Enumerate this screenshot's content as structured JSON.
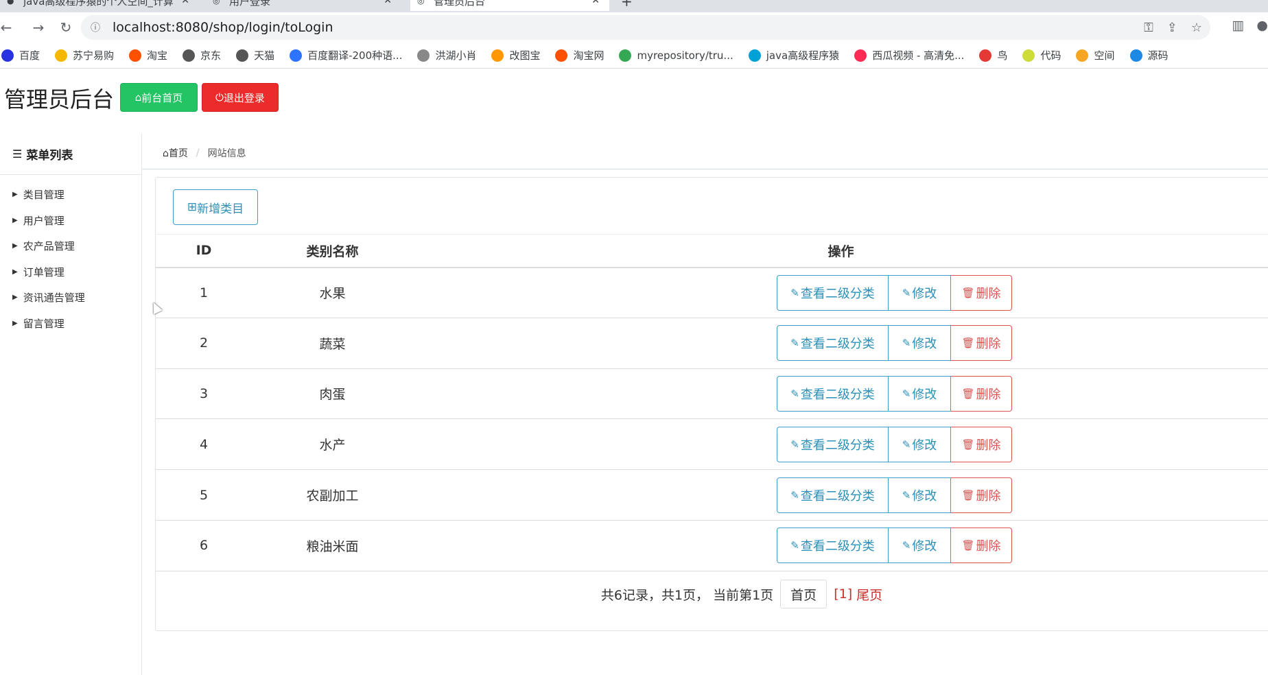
{
  "browser": {
    "tabs": [
      {
        "label": "java高级程序猿的个人空间_计算"
      },
      {
        "label": "用户登录"
      },
      {
        "label": "管理员后台"
      }
    ],
    "url": "localhost:8080/shop/login/toLogin",
    "bookmarks": [
      {
        "label": "百度",
        "color": "#2932e1"
      },
      {
        "label": "苏宁易购",
        "color": "#f5b800"
      },
      {
        "label": "淘宝",
        "color": "#ff5000"
      },
      {
        "label": "京东",
        "color": "#555555"
      },
      {
        "label": "天猫",
        "color": "#555555"
      },
      {
        "label": "百度翻译-200种语...",
        "color": "#2c73ff"
      },
      {
        "label": "洪湖小肖",
        "color": "#888888"
      },
      {
        "label": "改图宝",
        "color": "#ff9800"
      },
      {
        "label": "淘宝网",
        "color": "#ff5000"
      },
      {
        "label": "myrepository/tru...",
        "color": "#34a853"
      },
      {
        "label": "java高级程序猿",
        "color": "#00a1d6"
      },
      {
        "label": "西瓜视频 - 高清免...",
        "color": "#fe2c55"
      },
      {
        "label": "鸟",
        "color": "#e53935"
      },
      {
        "label": "代码",
        "color": "#cddc39"
      },
      {
        "label": "空间",
        "color": "#f5a623"
      },
      {
        "label": "源码",
        "color": "#1e88e5"
      }
    ]
  },
  "header": {
    "title": "管理员后台",
    "home_label": "前台首页",
    "logout_label": "退出登录"
  },
  "sidebar": {
    "title": "菜单列表",
    "items": [
      {
        "label": "类目管理"
      },
      {
        "label": "用户管理"
      },
      {
        "label": "农产品管理"
      },
      {
        "label": "订单管理"
      },
      {
        "label": "资讯通告管理"
      },
      {
        "label": "留言管理"
      }
    ]
  },
  "breadcrumb": {
    "home": "首页",
    "current": "网站信息"
  },
  "main": {
    "add_label": "新增类目",
    "columns": [
      "ID",
      "类别名称",
      "操作"
    ],
    "rows": [
      {
        "id": "1",
        "name": "水果"
      },
      {
        "id": "2",
        "name": "蔬菜"
      },
      {
        "id": "3",
        "name": "肉蛋"
      },
      {
        "id": "4",
        "name": "水产"
      },
      {
        "id": "5",
        "name": "农副加工"
      },
      {
        "id": "6",
        "name": "粮油米面"
      }
    ],
    "ops": {
      "view": "查看二级分类",
      "edit": "修改",
      "delete": "删除"
    },
    "pager": {
      "summary": "共6记录，共1页， 当前第1页",
      "first": "首页",
      "current": "[1]",
      "last": "尾页"
    }
  }
}
